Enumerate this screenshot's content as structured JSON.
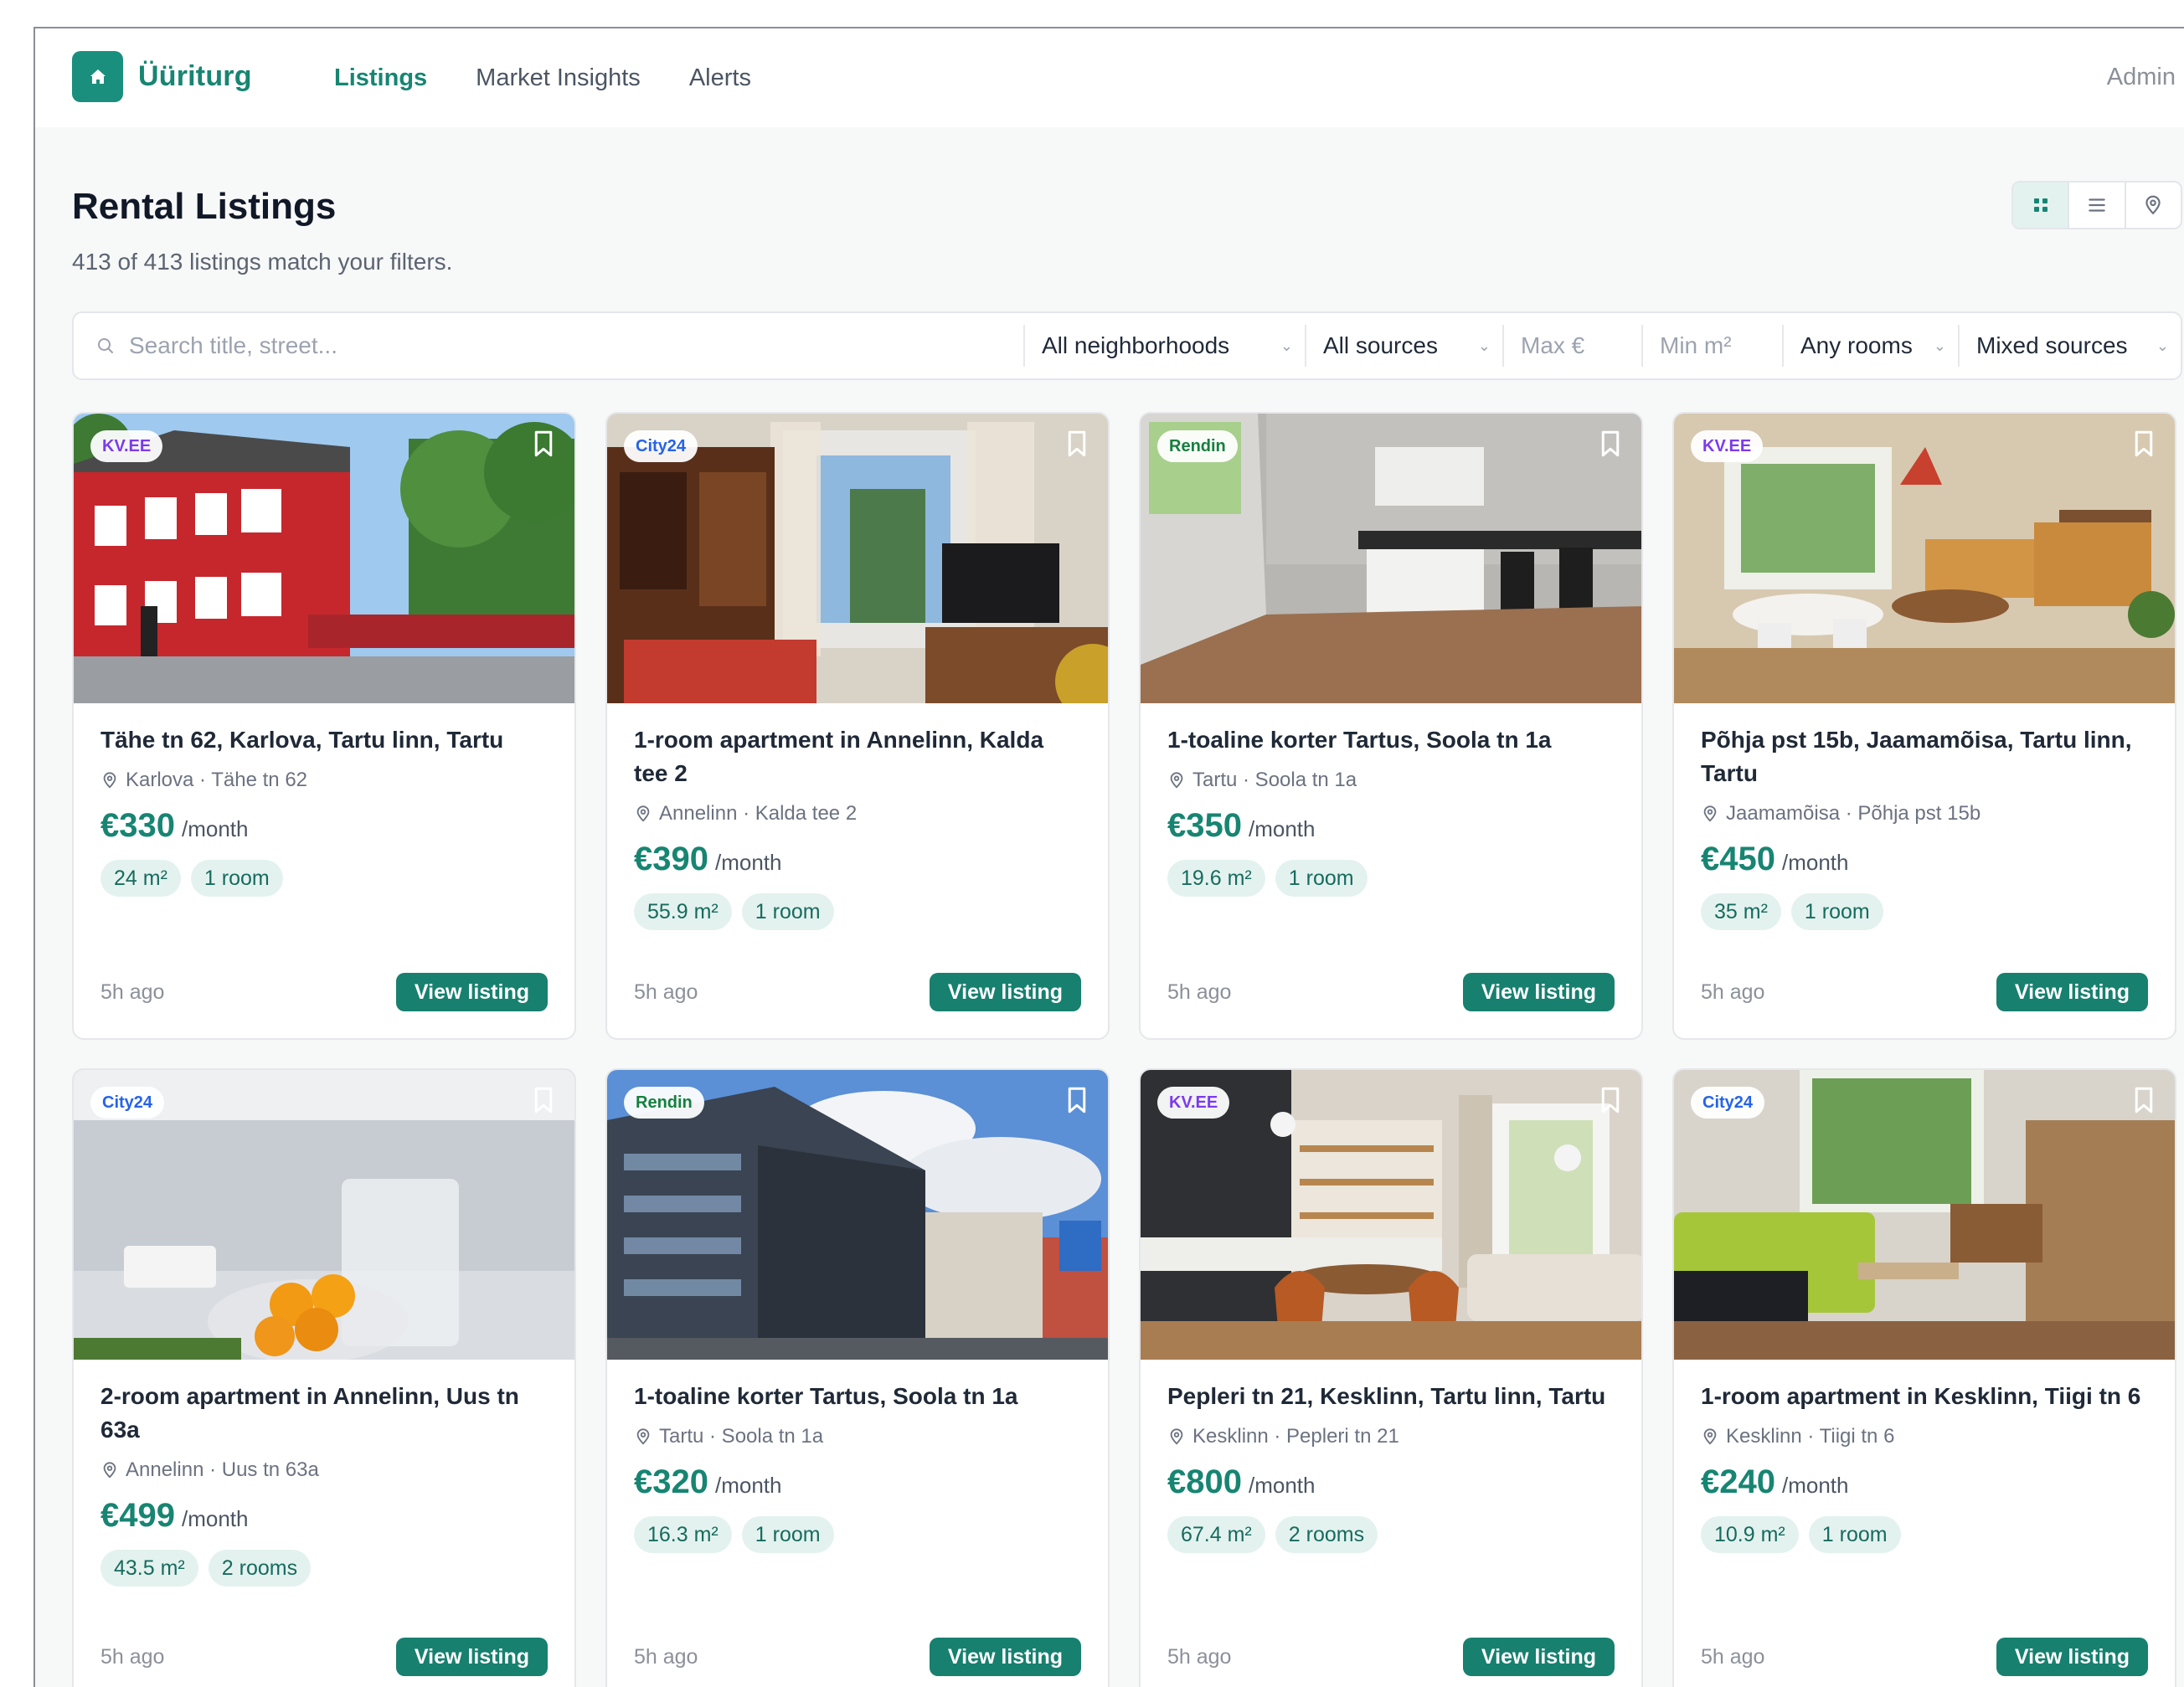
{
  "app": {
    "brand_name": "Üüriturg",
    "logo_icon": "home-icon",
    "nav": [
      {
        "label": "Listings",
        "active": true
      },
      {
        "label": "Market Insights",
        "active": false
      },
      {
        "label": "Alerts",
        "active": false
      }
    ],
    "user_label": "Admin",
    "accent_color": "#178572"
  },
  "page": {
    "title": "Rental Listings",
    "subtitle": "413 of 413 listings match your filters.",
    "view_modes": [
      "grid-icon",
      "list-icon",
      "map-pin-icon"
    ],
    "active_view": "grid"
  },
  "filters": {
    "search_placeholder": "Search title, street...",
    "neighborhood": "All neighborhoods",
    "source": "All sources",
    "max_price_placeholder": "Max €",
    "min_area_placeholder": "Min m²",
    "rooms": "Any rooms",
    "sort": "Mixed sources"
  },
  "listings": [
    {
      "source": "KV.EE",
      "title": "Tähe tn 62, Karlova, Tartu linn, Tartu",
      "location": "Karlova · Tähe tn 62",
      "price": "€330",
      "unit": "/month",
      "area": "24 m²",
      "rooms": "1 room",
      "posted": "5h ago",
      "cta": "View listing"
    },
    {
      "source": "City24",
      "title": "1-room apartment in Annelinn, Kalda tee 2",
      "location": "Annelinn · Kalda tee 2",
      "price": "€390",
      "unit": "/month",
      "area": "55.9 m²",
      "rooms": "1 room",
      "posted": "5h ago",
      "cta": "View listing"
    },
    {
      "source": "Rendin",
      "title": "1-toaline korter Tartus, Soola tn 1a",
      "location": "Tartu · Soola tn 1a",
      "price": "€350",
      "unit": "/month",
      "area": "19.6 m²",
      "rooms": "1 room",
      "posted": "5h ago",
      "cta": "View listing"
    },
    {
      "source": "KV.EE",
      "title": "Põhja pst 15b, Jaamamõisa, Tartu linn, Tartu",
      "location": "Jaamamõisa · Põhja pst 15b",
      "price": "€450",
      "unit": "/month",
      "area": "35 m²",
      "rooms": "1 room",
      "posted": "5h ago",
      "cta": "View listing"
    },
    {
      "source": "City24",
      "title": "2-room apartment in Annelinn, Uus tn 63a",
      "location": "Annelinn · Uus tn 63a",
      "price": "€499",
      "unit": "/month",
      "area": "43.5 m²",
      "rooms": "2 rooms",
      "posted": "5h ago",
      "cta": "View listing"
    },
    {
      "source": "Rendin",
      "title": "1-toaline korter Tartus, Soola tn 1a",
      "location": "Tartu · Soola tn 1a",
      "price": "€320",
      "unit": "/month",
      "area": "16.3 m²",
      "rooms": "1 room",
      "posted": "5h ago",
      "cta": "View listing"
    },
    {
      "source": "KV.EE",
      "title": "Pepleri tn 21, Kesklinn, Tartu linn, Tartu",
      "location": "Kesklinn · Pepleri tn 21",
      "price": "€800",
      "unit": "/month",
      "area": "67.4 m²",
      "rooms": "2 rooms",
      "posted": "5h ago",
      "cta": "View listing"
    },
    {
      "source": "City24",
      "title": "1-room apartment in Kesklinn, Tiigi tn 6",
      "location": "Kesklinn · Tiigi tn 6",
      "price": "€240",
      "unit": "/month",
      "area": "10.9 m²",
      "rooms": "1 room",
      "posted": "5h ago",
      "cta": "View listing"
    }
  ],
  "source_colors": {
    "KV.EE": "#7c3aed",
    "City24": "#2563eb",
    "Rendin": "#15803d"
  }
}
